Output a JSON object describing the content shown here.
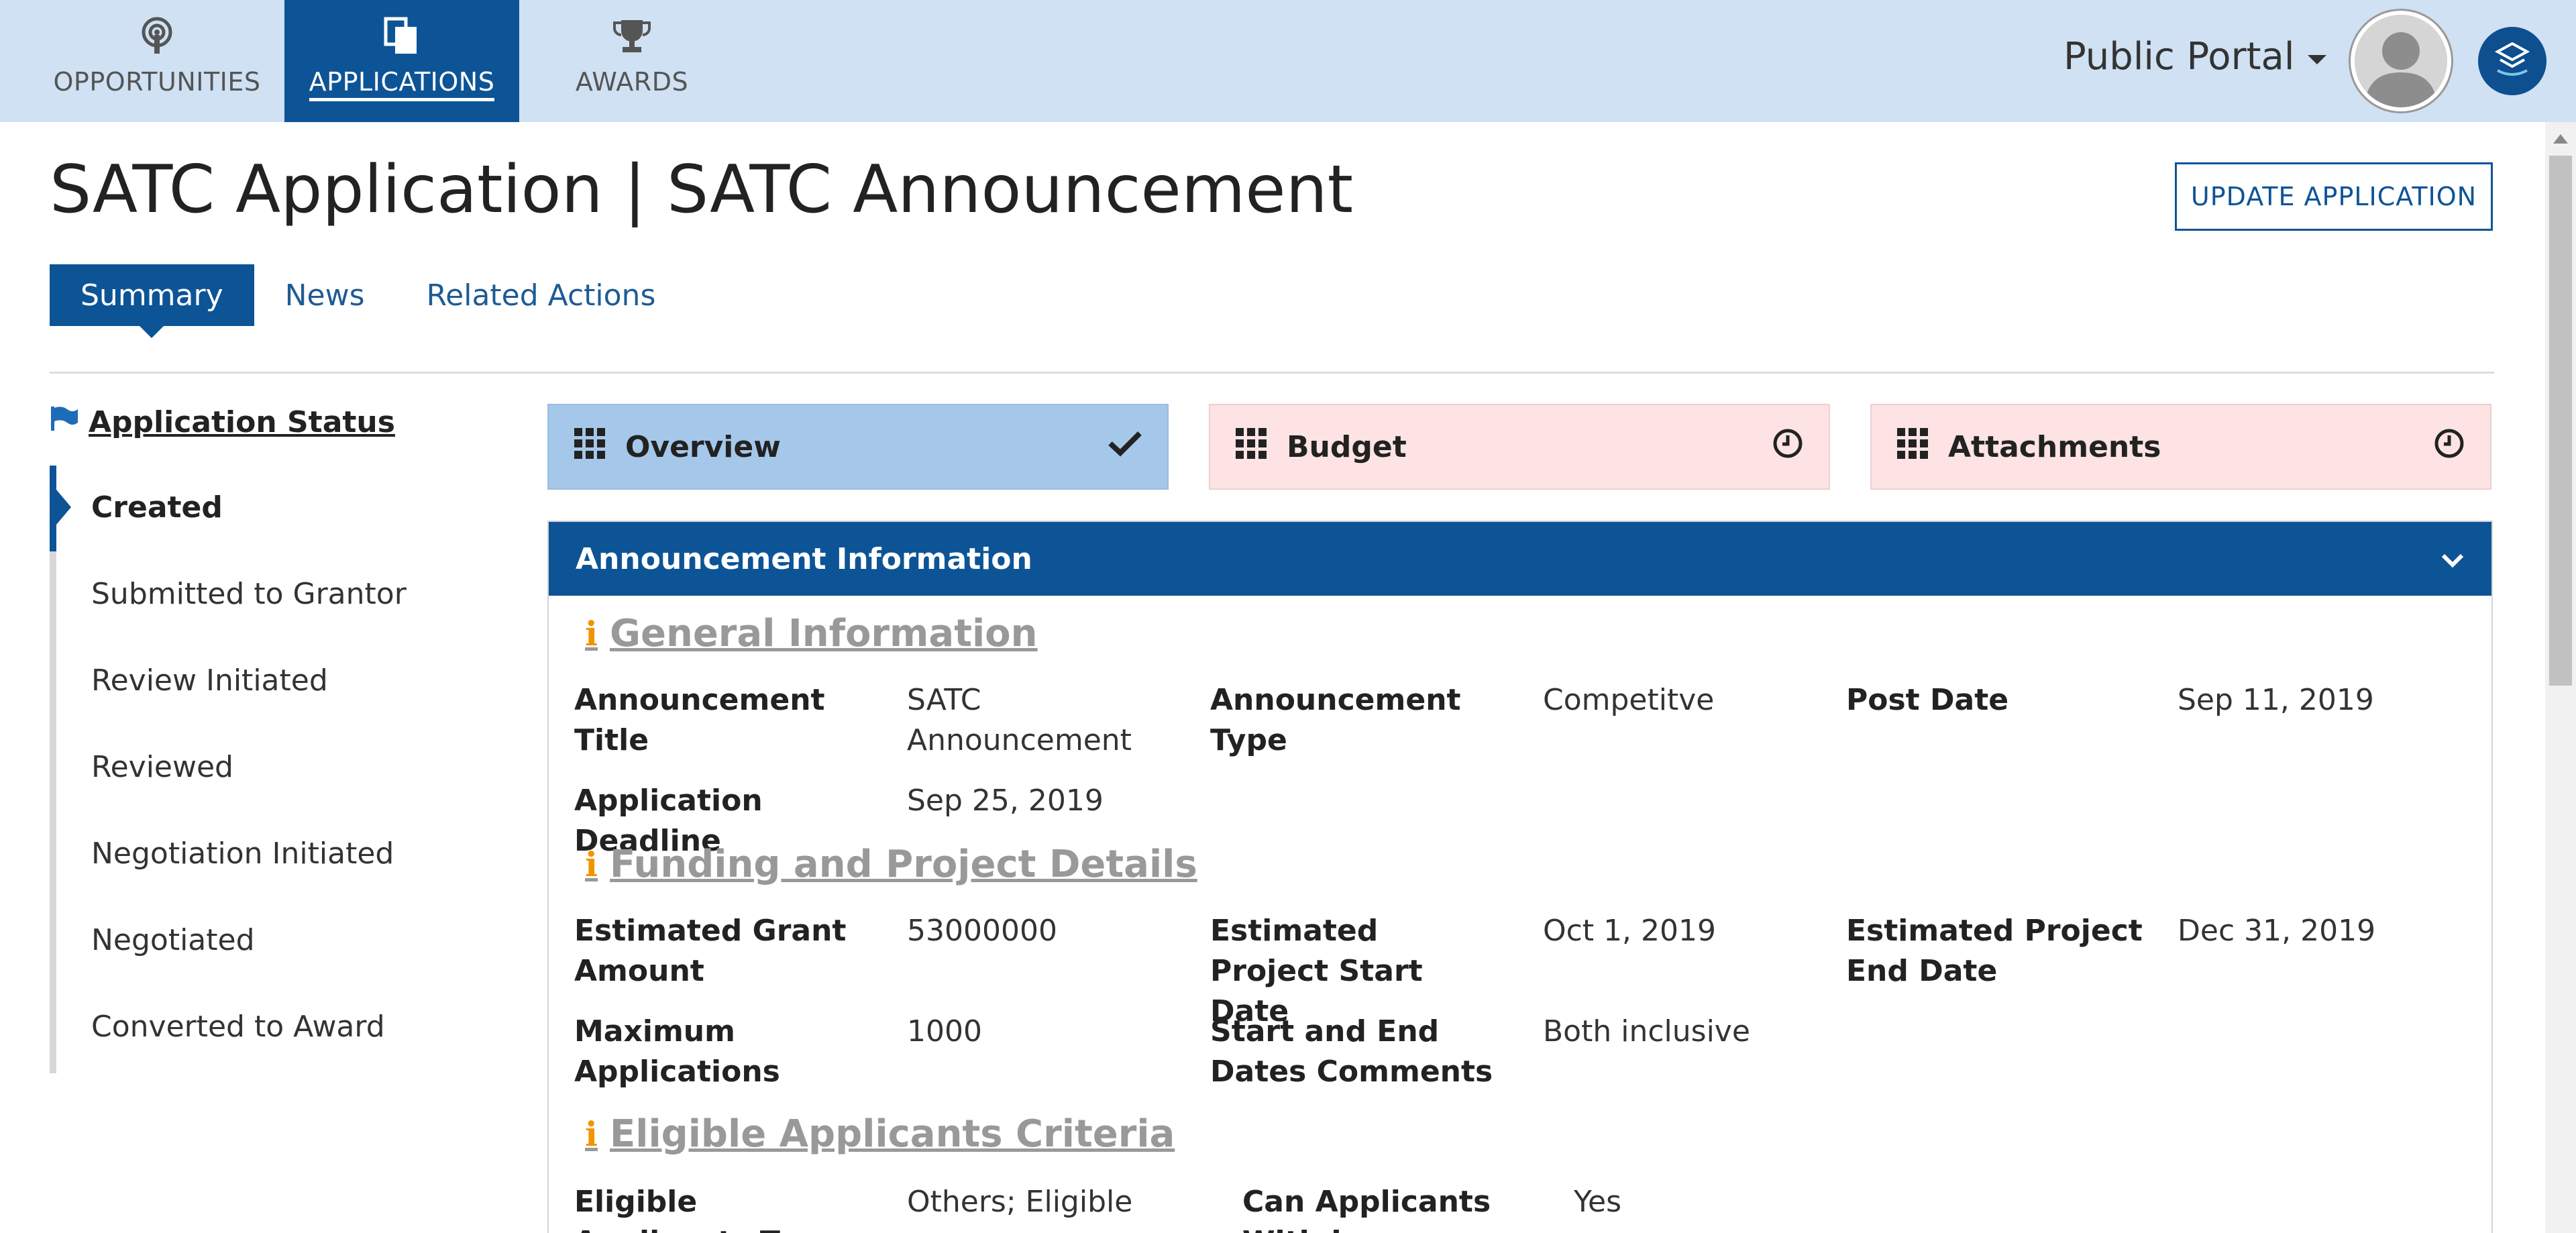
{
  "nav": {
    "tabs": [
      {
        "label": "OPPORTUNITIES",
        "icon": "podcast-icon"
      },
      {
        "label": "APPLICATIONS",
        "icon": "documents-icon"
      },
      {
        "label": "AWARDS",
        "icon": "trophy-icon"
      }
    ],
    "active_tab": "APPLICATIONS",
    "portal_label": "Public Portal"
  },
  "header": {
    "title": "SATC Application | SATC Announcement",
    "update_button": "UPDATE APPLICATION"
  },
  "subtabs": [
    "Summary",
    "News",
    "Related Actions"
  ],
  "status": {
    "heading": "Application Status",
    "items": [
      "Created",
      "Submitted to Grantor",
      "Review Initiated",
      "Reviewed",
      "Negotiation Initiated",
      "Negotiated",
      "Converted to Award"
    ],
    "current": "Created"
  },
  "cards": [
    {
      "label": "Overview",
      "state": "complete",
      "icon": "check-icon"
    },
    {
      "label": "Budget",
      "state": "pending",
      "icon": "clock-icon"
    },
    {
      "label": "Attachments",
      "state": "pending",
      "icon": "clock-icon"
    }
  ],
  "panel": {
    "heading": "Announcement Information",
    "general": {
      "title": "General Information",
      "announcement_title_label": "Announcement Title",
      "announcement_title_value": "SATC Announcement",
      "announcement_type_label": "Announcement Type",
      "announcement_type_value": "Competitve",
      "post_date_label": "Post Date",
      "post_date_value": "Sep 11, 2019",
      "deadline_label": "Application Deadline",
      "deadline_value": "Sep 25, 2019"
    },
    "funding": {
      "title": "Funding and Project Details",
      "grant_amount_label": "Estimated Grant Amount",
      "grant_amount_value": "53000000",
      "start_label": "Estimated Project Start Date",
      "start_value": "Oct 1, 2019",
      "end_label": "Estimated Project End Date",
      "end_value": "Dec 31, 2019",
      "max_apps_label": "Maximum Applications",
      "max_apps_value": "1000",
      "comments_label": "Start and End Dates Comments",
      "comments_value": "Both inclusive"
    },
    "eligibility": {
      "title": "Eligible Applicants Criteria",
      "types_label": "Eligible Applicants Types",
      "types_value": "Others; Eligible",
      "withdraw_label": "Can Applicants Withdraw",
      "withdraw_value": "Yes"
    }
  },
  "colors": {
    "brand": "#0d5496",
    "topbar": "#cfe1f3",
    "complete": "#a5c8ea",
    "pending": "#fde3e3",
    "info": "#f29400"
  }
}
